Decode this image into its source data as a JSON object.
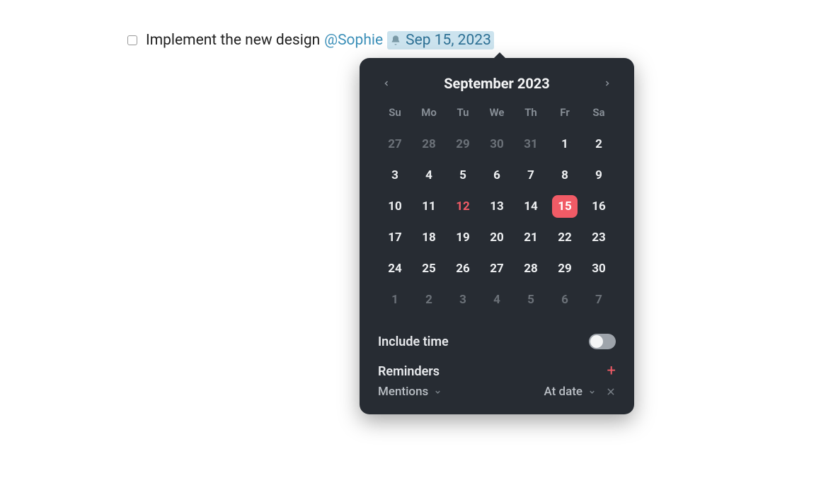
{
  "task": {
    "text": "Implement the new design",
    "mention": "@Sophie",
    "date_label": "Sep 15, 2023"
  },
  "calendar": {
    "title": "September 2023",
    "dow": [
      "Su",
      "Mo",
      "Tu",
      "We",
      "Th",
      "Fr",
      "Sa"
    ],
    "weeks": [
      [
        {
          "n": "27",
          "o": true
        },
        {
          "n": "28",
          "o": true
        },
        {
          "n": "29",
          "o": true
        },
        {
          "n": "30",
          "o": true
        },
        {
          "n": "31",
          "o": true
        },
        {
          "n": "1"
        },
        {
          "n": "2"
        }
      ],
      [
        {
          "n": "3"
        },
        {
          "n": "4"
        },
        {
          "n": "5"
        },
        {
          "n": "6"
        },
        {
          "n": "7"
        },
        {
          "n": "8"
        },
        {
          "n": "9"
        }
      ],
      [
        {
          "n": "10"
        },
        {
          "n": "11"
        },
        {
          "n": "12",
          "today": true
        },
        {
          "n": "13"
        },
        {
          "n": "14"
        },
        {
          "n": "15",
          "sel": true
        },
        {
          "n": "16"
        }
      ],
      [
        {
          "n": "17"
        },
        {
          "n": "18"
        },
        {
          "n": "19"
        },
        {
          "n": "20"
        },
        {
          "n": "21"
        },
        {
          "n": "22"
        },
        {
          "n": "23"
        }
      ],
      [
        {
          "n": "24"
        },
        {
          "n": "25"
        },
        {
          "n": "26"
        },
        {
          "n": "27"
        },
        {
          "n": "28"
        },
        {
          "n": "29"
        },
        {
          "n": "30"
        }
      ],
      [
        {
          "n": "1",
          "o": true
        },
        {
          "n": "2",
          "o": true
        },
        {
          "n": "3",
          "o": true
        },
        {
          "n": "4",
          "o": true
        },
        {
          "n": "5",
          "o": true
        },
        {
          "n": "6",
          "o": true
        },
        {
          "n": "7",
          "o": true
        }
      ]
    ]
  },
  "options": {
    "include_time_label": "Include time",
    "include_time_on": false,
    "reminders_label": "Reminders",
    "reminder_type": "Mentions",
    "reminder_when": "At date"
  }
}
